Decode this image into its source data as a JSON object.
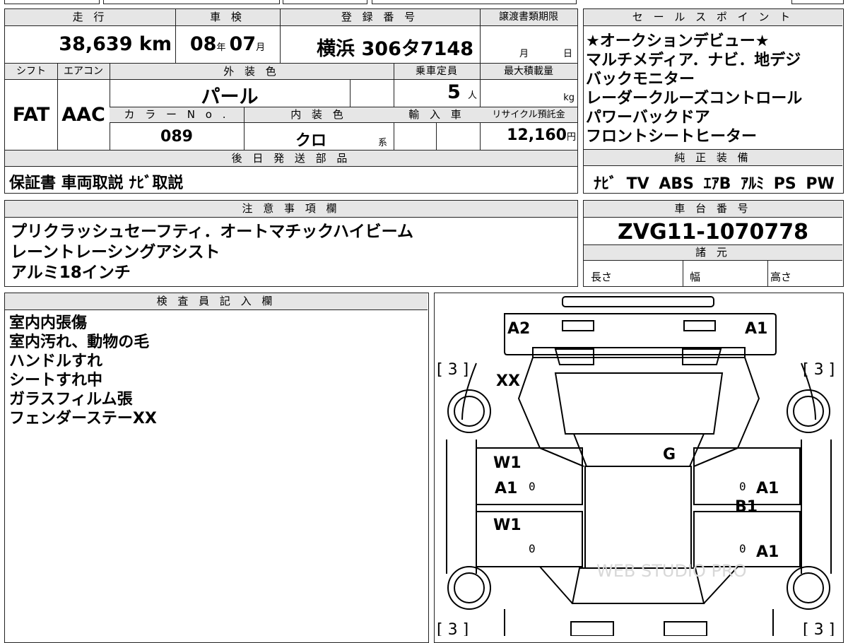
{
  "headers": {
    "mileage": "走 行",
    "inspection": "車 検",
    "registration": "登 録 番 号",
    "transfer_deadline": "譲渡書類期限",
    "shift": "シフト",
    "aircon": "エアコン",
    "exterior_color": "外 装 色",
    "capacity": "乗車定員",
    "max_load": "最大積載量",
    "color_no": "カ ラ ー N o .",
    "interior_color": "内 装 色",
    "import": "輸 入 車",
    "recycle": "リサイクル預託金",
    "later_parts": "後 日 発 送 部 品",
    "notes": "注 意 事 項 欄",
    "inspector": "検 査 員 記 入 欄",
    "sales_points": "セ ー ル ス ポ イ ン ト",
    "equipment": "純 正 装 備",
    "chassis": "車 台 番 号",
    "specs": "諸 元"
  },
  "vehicle": {
    "mileage": "38,639",
    "mileage_unit": "km",
    "inspection_year": "08",
    "year_unit": "年",
    "inspection_month": "07",
    "month_unit": "月",
    "registration": "横浜 306タ7148",
    "deadline_month": "月",
    "deadline_day": "日",
    "shift": "FAT",
    "aircon": "AAC",
    "exterior_color": "パール",
    "capacity": "5",
    "capacity_unit": "人",
    "load_unit": "kg",
    "color_no": "089",
    "interior_color": "クロ",
    "interior_suffix": "系",
    "recycle_fee": "12,160",
    "yen_unit": "円",
    "later_parts": "保証書 車両取説 ﾅﾋﾞ取説",
    "chassis": "ZVG11-1070778"
  },
  "notes_lines": [
    "プリクラッシュセーフティ．オートマチックハイビーム",
    "レーントレーシングアシスト",
    "アルミ18インチ"
  ],
  "inspector_lines": [
    "室内内張傷",
    "室内汚れ、動物の毛",
    "ハンドルすれ",
    "シートすれ中",
    "ガラスフィルム張",
    "フェンダーステーXX"
  ],
  "sales_points": [
    "★オークションデビュー★",
    "マルチメディア．ナビ．地デジ",
    "バックモニター",
    "レーダークルーズコントロール",
    "パワーバックドア",
    "フロントシートヒーター"
  ],
  "equipment": "ﾅﾋﾞ TV ABS ｴｱB ｱﾙﾐ PS PW",
  "specs": {
    "length": "長さ",
    "width": "幅",
    "height": "高さ"
  },
  "diagram": {
    "top_left": "A2",
    "top_right": "A1",
    "rating_tl": "[ 3 ]",
    "rating_tr": "[ 3 ]",
    "rating_bl": "[ 3 ]",
    "rating_br": "[ 3 ]",
    "front_left_mark": "XX",
    "glass": "G",
    "left_upper_w": "W1",
    "left_upper_a": "A1",
    "left_lower_w": "W1",
    "right_upper_a": "A1",
    "right_upper_b": "B1",
    "right_lower_a": "A1",
    "zero": "0"
  },
  "watermark": "WEB STUDIO PRO"
}
